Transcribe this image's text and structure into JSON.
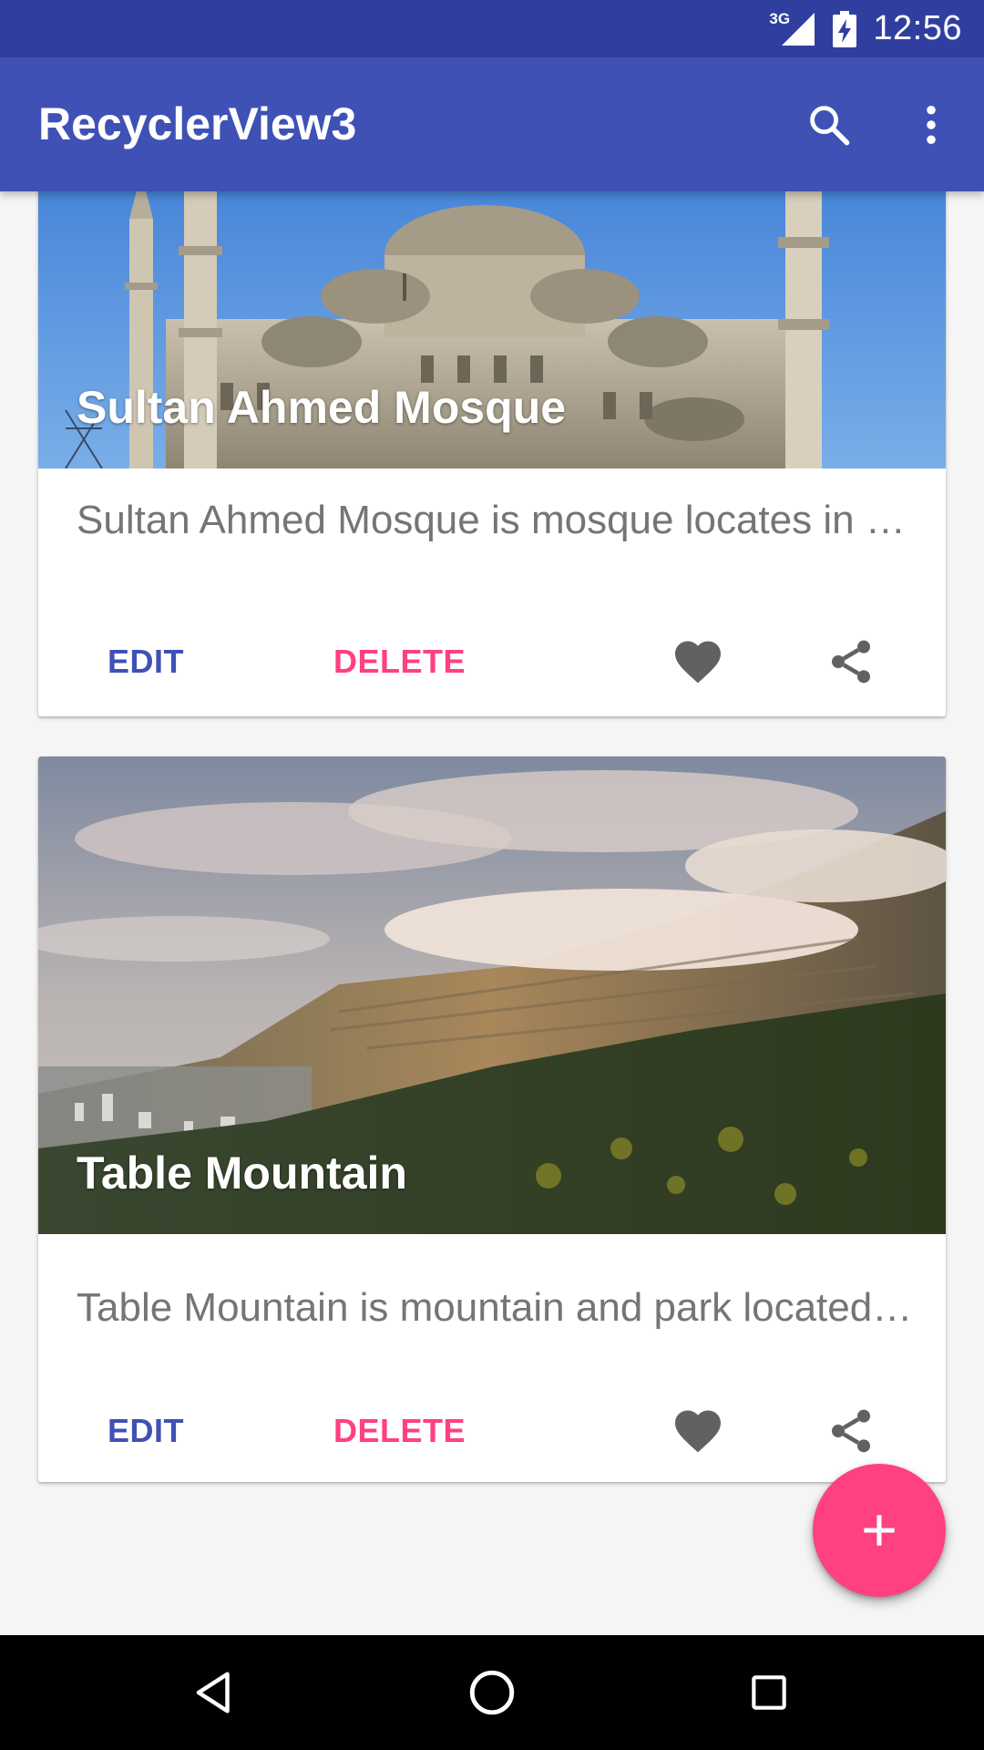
{
  "status_bar": {
    "network_type": "3G",
    "time": "12:56",
    "background": "#303f9f"
  },
  "app_bar": {
    "title": "RecyclerView3",
    "background": "#3f51b5",
    "actions": [
      "search-icon",
      "more-vert-icon"
    ]
  },
  "cards": [
    {
      "title": "Sultan Ahmed Mosque",
      "description": "Sultan Ahmed Mosque is mosque locates in Istanbul, Turkey",
      "edit_label": "EDIT",
      "delete_label": "DELETE",
      "favorite_icon": "heart-icon",
      "share_icon": "share-icon"
    },
    {
      "title": "Table Mountain",
      "description": "Table Mountain is mountain and park located in Cape Town",
      "edit_label": "EDIT",
      "delete_label": "DELETE",
      "favorite_icon": "heart-icon",
      "share_icon": "share-icon"
    }
  ],
  "fab": {
    "icon": "add-icon",
    "color": "#ff4081"
  },
  "colors": {
    "primary": "#3f51b5",
    "primary_dark": "#303f9f",
    "accent": "#ff4081",
    "description_text": "#757575",
    "icon_gray": "#616161"
  },
  "nav_bar": {
    "buttons": [
      "back-icon",
      "home-icon",
      "recents-icon"
    ]
  }
}
